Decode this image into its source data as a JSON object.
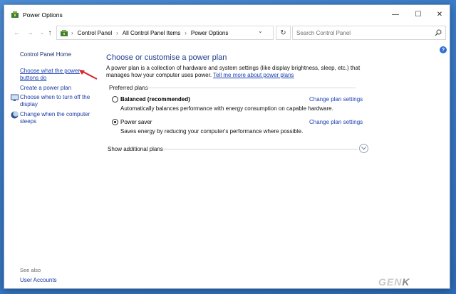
{
  "window": {
    "title": "Power Options",
    "minimize_glyph": "—",
    "maximize_glyph": "☐",
    "close_glyph": "✕"
  },
  "nav": {
    "back_glyph": "←",
    "forward_glyph": "→",
    "recent_glyph": "⌄",
    "up_glyph": "↑",
    "refresh_glyph": "↻",
    "dropdown_glyph": "⌄"
  },
  "breadcrumb": {
    "items": [
      "Control Panel",
      "All Control Panel Items",
      "Power Options"
    ],
    "separator": "›"
  },
  "search": {
    "placeholder": "Search Control Panel"
  },
  "sidebar": {
    "home": "Control Panel Home",
    "items": [
      {
        "label_line1": "Choose what the power",
        "label_line2": "buttons do"
      },
      {
        "label_line1": "Create a power plan",
        "label_line2": ""
      },
      {
        "label_line1": "Choose when to turn off the",
        "label_line2": "display"
      },
      {
        "label_line1": "Change when the computer",
        "label_line2": "sleeps"
      }
    ],
    "see_also": "See also",
    "user_accounts": "User Accounts"
  },
  "main": {
    "heading": "Choose or customise a power plan",
    "description": "A power plan is a collection of hardware and system settings (like display brightness, sleep, etc.) that manages how your computer uses power.",
    "tell_me_more": "Tell me more about power plans",
    "preferred_label": "Preferred plans",
    "plans": [
      {
        "name": "Balanced (recommended)",
        "description": "Automatically balances performance with energy consumption on capable hardware.",
        "change_label": "Change plan settings",
        "selected": false
      },
      {
        "name": "Power saver",
        "description": "Saves energy by reducing your computer's performance where possible.",
        "change_label": "Change plan settings",
        "selected": true
      }
    ],
    "show_additional": "Show additional plans"
  },
  "help": {
    "glyph": "?"
  },
  "watermark": {
    "text_main": "GEN",
    "text_k": "K"
  },
  "colors": {
    "link": "#1b3fb0",
    "heading": "#1e3a8a",
    "arrow": "#d8232a"
  }
}
